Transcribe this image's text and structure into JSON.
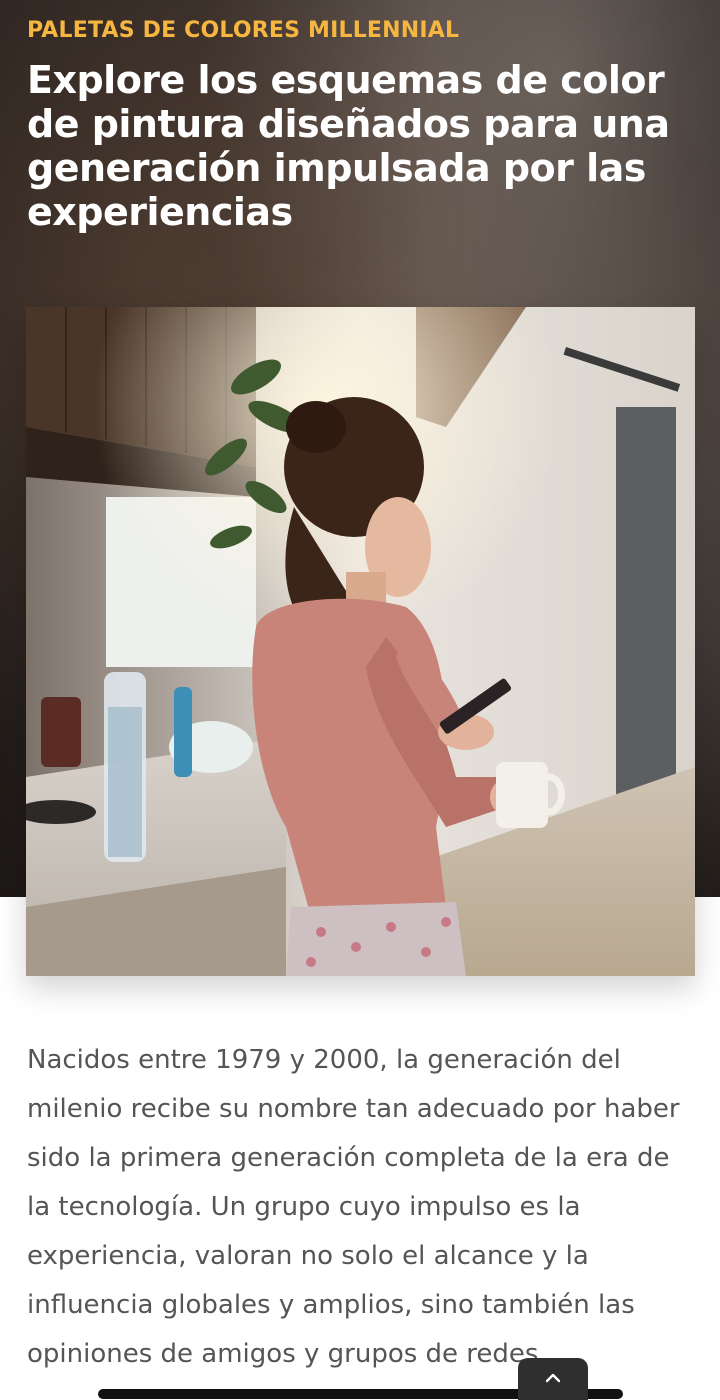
{
  "hero": {
    "eyebrow": "PALETAS DE COLORES MILLENNIAL",
    "title": "Explore los esquemas de color de pintura diseñados para una generación impulsada por las experiencias"
  },
  "photo": {
    "icon": "photo-woman-kitchen-phone"
  },
  "article": {
    "paragraph": "Nacidos entre 1979 y 2000, la generación del milenio recibe su nombre tan adecuado por haber sido la primera generación completa de la era de la tecnología. Un grupo cuyo impulso es la experiencia, valoran no solo el alcance y la influencia globales y amplios, sino también las opiniones de amigos y grupos de redes"
  },
  "colors": {
    "eyebrow": "#f6b640",
    "title": "#ffffff",
    "body_text": "#555555"
  },
  "controls": {
    "scroll_top_icon": "chevron-up-icon"
  }
}
